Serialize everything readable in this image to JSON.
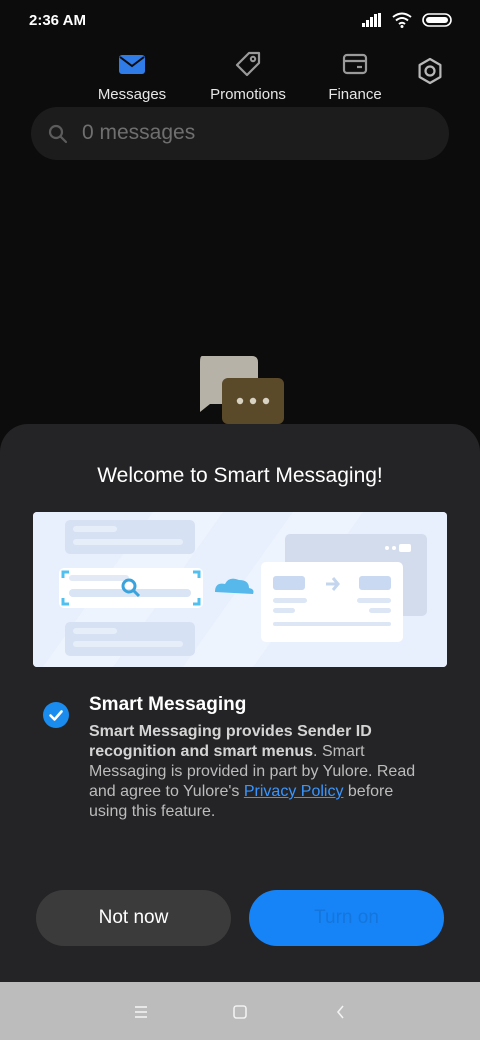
{
  "status_bar": {
    "time": "2:36 AM",
    "icons": [
      "signal-icon",
      "wifi-icon",
      "battery-icon"
    ]
  },
  "tabs": [
    {
      "label": "Messages",
      "icon": "envelope-icon",
      "active": true
    },
    {
      "label": "Promotions",
      "icon": "tag-icon",
      "active": false
    },
    {
      "label": "Finance",
      "icon": "card-icon",
      "active": false
    }
  ],
  "search": {
    "text": "0 messages"
  },
  "dialog": {
    "title": "Welcome to Smart Messaging!",
    "option": {
      "title": "Smart Messaging",
      "checked": true,
      "desc_bold": "Smart Messaging provides Sender ID recognition and smart menus",
      "desc_text": ". Smart Messaging is provided in part by Yulore. Read and agree to Yulore's ",
      "link": "Privacy Policy",
      "desc_tail": " before using this feature."
    },
    "buttons": {
      "not_now": "Not now",
      "turn_on": "Turn on"
    }
  },
  "colors": {
    "accent": "#1684f7",
    "sheet_bg": "#242426",
    "page_bg": "#0c0c0c",
    "link": "#3a96ff"
  }
}
